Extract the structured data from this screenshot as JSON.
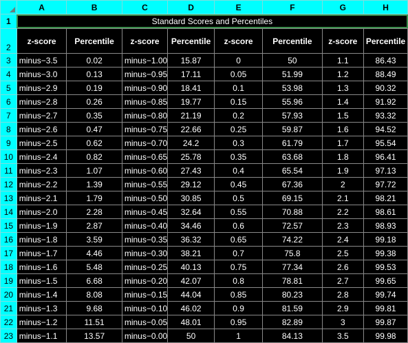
{
  "columns": [
    "A",
    "B",
    "C",
    "D",
    "E",
    "F",
    "G",
    "H"
  ],
  "title": "Standard Scores and Percentiles",
  "headers": [
    "z-score",
    "Percentile",
    "z-score",
    "Percentile",
    "z-score",
    "Percentile",
    "z-score",
    "Percentile"
  ],
  "row_numbers": [
    "1",
    "2",
    "3",
    "4",
    "5",
    "6",
    "7",
    "8",
    "9",
    "10",
    "11",
    "12",
    "13",
    "14",
    "15",
    "16",
    "17",
    "18",
    "19",
    "20",
    "21",
    "22",
    "23"
  ],
  "rows": [
    [
      "minus−3.5",
      "0.02",
      "minus−1.00",
      "15.87",
      "0",
      "50",
      "1.1",
      "86.43"
    ],
    [
      "minus−3.0",
      "0.13",
      "minus−0.95",
      "17.11",
      "0.05",
      "51.99",
      "1.2",
      "88.49"
    ],
    [
      "minus−2.9",
      "0.19",
      "minus−0.90",
      "18.41",
      "0.1",
      "53.98",
      "1.3",
      "90.32"
    ],
    [
      "minus−2.8",
      "0.26",
      "minus−0.85",
      "19.77",
      "0.15",
      "55.96",
      "1.4",
      "91.92"
    ],
    [
      "minus−2.7",
      "0.35",
      "minus−0.80",
      "21.19",
      "0.2",
      "57.93",
      "1.5",
      "93.32"
    ],
    [
      "minus−2.6",
      "0.47",
      "minus−0.75",
      "22.66",
      "0.25",
      "59.87",
      "1.6",
      "94.52"
    ],
    [
      "minus−2.5",
      "0.62",
      "minus−0.70",
      "24.2",
      "0.3",
      "61.79",
      "1.7",
      "95.54"
    ],
    [
      "minus−2.4",
      "0.82",
      "minus−0.65",
      "25.78",
      "0.35",
      "63.68",
      "1.8",
      "96.41"
    ],
    [
      "minus−2.3",
      "1.07",
      "minus−0.60",
      "27.43",
      "0.4",
      "65.54",
      "1.9",
      "97.13"
    ],
    [
      "minus−2.2",
      "1.39",
      "minus−0.55",
      "29.12",
      "0.45",
      "67.36",
      "2",
      "97.72"
    ],
    [
      "minus−2.1",
      "1.79",
      "minus−0.50",
      "30.85",
      "0.5",
      "69.15",
      "2.1",
      "98.21"
    ],
    [
      "minus−2.0",
      "2.28",
      "minus−0.45",
      "32.64",
      "0.55",
      "70.88",
      "2.2",
      "98.61"
    ],
    [
      "minus−1.9",
      "2.87",
      "minus−0.40",
      "34.46",
      "0.6",
      "72.57",
      "2.3",
      "98.93"
    ],
    [
      "minus−1.8",
      "3.59",
      "minus−0.35",
      "36.32",
      "0.65",
      "74.22",
      "2.4",
      "99.18"
    ],
    [
      "minus−1.7",
      "4.46",
      "minus−0.30",
      "38.21",
      "0.7",
      "75.8",
      "2.5",
      "99.38"
    ],
    [
      "minus−1.6",
      "5.48",
      "minus−0.25",
      "40.13",
      "0.75",
      "77.34",
      "2.6",
      "99.53"
    ],
    [
      "minus−1.5",
      "6.68",
      "minus−0.20",
      "42.07",
      "0.8",
      "78.81",
      "2.7",
      "99.65"
    ],
    [
      "minus−1.4",
      "8.08",
      "minus−0.15",
      "44.04",
      "0.85",
      "80.23",
      "2.8",
      "99.74"
    ],
    [
      "minus−1.3",
      "9.68",
      "minus−0.10",
      "46.02",
      "0.9",
      "81.59",
      "2.9",
      "99.81"
    ],
    [
      "minus−1.2",
      "11.51",
      "minus−0.05",
      "48.01",
      "0.95",
      "82.89",
      "3",
      "99.87"
    ],
    [
      "minus−1.1",
      "13.57",
      "minus−0.00",
      "50",
      "1",
      "84.13",
      "3.5",
      "99.98"
    ]
  ],
  "colors": {
    "header_bg": "#00ffff",
    "grid_bg": "#000000",
    "text": "#ffffff",
    "selection": "#3c8f4d"
  }
}
